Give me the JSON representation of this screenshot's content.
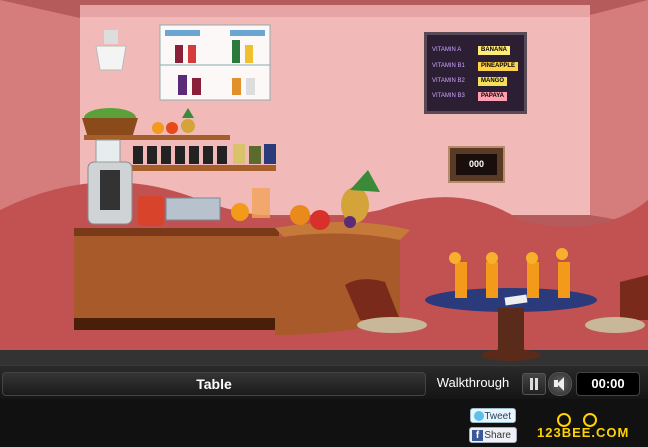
{
  "scene": {
    "name": "juice-bar-room",
    "vitamin_board": [
      {
        "label": "VITAMIN A",
        "value": "BANANA",
        "color": "#ffeb7a"
      },
      {
        "label": "VITAMIN B1",
        "value": "PINEAPPLE",
        "color": "#ffd24a"
      },
      {
        "label": "VITAMIN B2",
        "value": "MANGO",
        "color": "#f6e05a"
      },
      {
        "label": "VITAMIN B3",
        "value": "PAPAYA",
        "color": "#ff9fb0"
      }
    ],
    "code_box": "000"
  },
  "hud": {
    "current_item": "Table",
    "walkthrough": "Walkthrough",
    "timer": "00:00",
    "tweet": "Tweet",
    "share": "Share",
    "logo": "123BEE.COM"
  },
  "colors": {
    "wall": "#f4b2b2",
    "floor": "#c64a4a",
    "counter": "#a65a2a",
    "hud_bg": "#111111"
  }
}
